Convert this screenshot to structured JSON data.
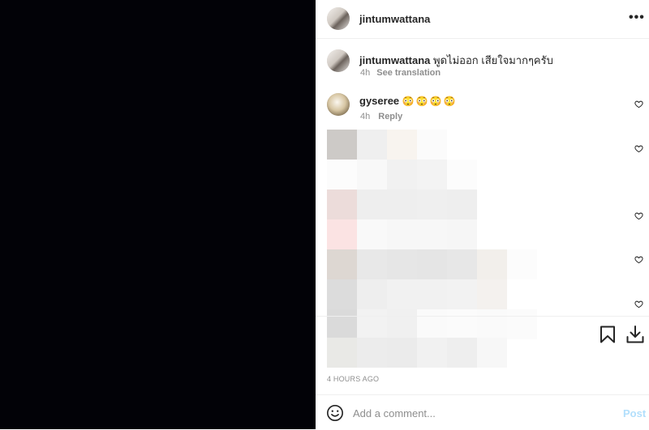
{
  "header": {
    "username": "jintumwattana",
    "more_icon": "more-horizontal-icon"
  },
  "caption": {
    "username": "jintumwattana",
    "text": "พูดไม่ออก เสียใจมากๆครับ",
    "time": "4h",
    "see_translation": "See translation"
  },
  "comments": [
    {
      "username": "gyseree",
      "text": "😳😳😳😳",
      "time": "4h",
      "reply": "Reply"
    }
  ],
  "actions": {
    "bookmark_icon": "bookmark-icon",
    "download_icon": "download-icon"
  },
  "timestamp": "4 HOURS AGO",
  "add_comment": {
    "placeholder": "Add a comment...",
    "post_label": "Post",
    "emoji_icon": "emoji-icon"
  }
}
